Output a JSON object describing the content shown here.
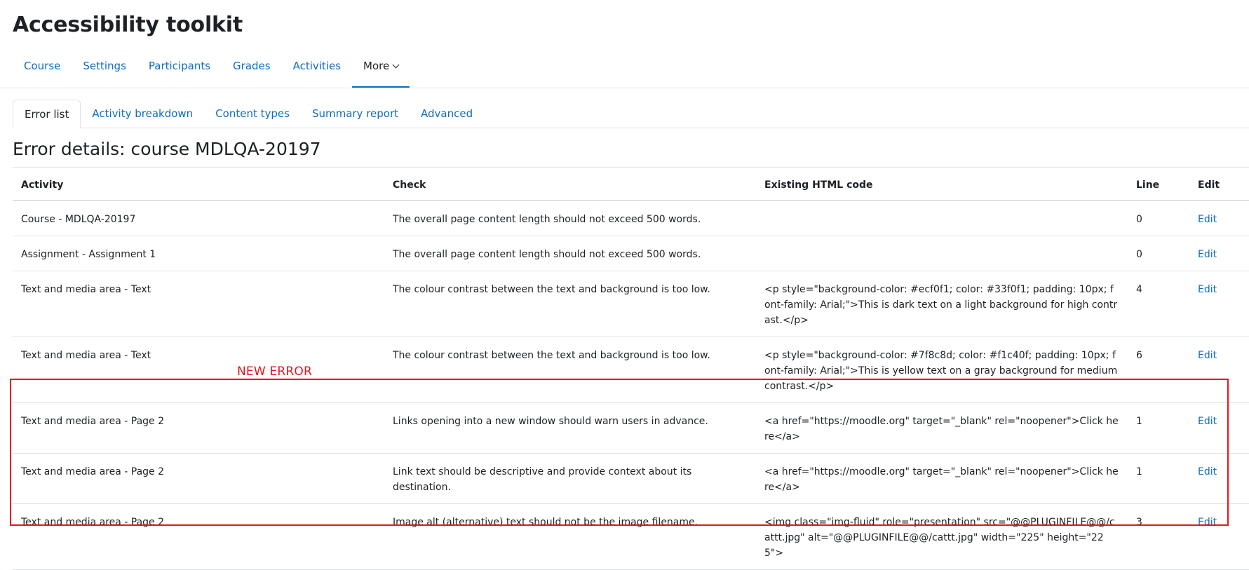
{
  "page": {
    "title": "Accessibility toolkit"
  },
  "primary_nav": {
    "items": [
      {
        "label": "Course"
      },
      {
        "label": "Settings"
      },
      {
        "label": "Participants"
      },
      {
        "label": "Grades"
      },
      {
        "label": "Activities"
      },
      {
        "label": "More"
      }
    ]
  },
  "tabs": {
    "items": [
      {
        "label": "Error list",
        "active": true
      },
      {
        "label": "Activity breakdown"
      },
      {
        "label": "Content types"
      },
      {
        "label": "Summary report"
      },
      {
        "label": "Advanced"
      }
    ]
  },
  "section": {
    "title": "Error details: course MDLQA-20197"
  },
  "table": {
    "headers": {
      "activity": "Activity",
      "check": "Check",
      "code": "Existing HTML code",
      "line": "Line",
      "edit": "Edit"
    },
    "rows": [
      {
        "activity": "Course - MDLQA-20197",
        "check": "The overall page content length should not exceed 500 words.",
        "code": "",
        "line": "0",
        "edit": "Edit"
      },
      {
        "activity": "Assignment - Assignment 1",
        "check": "The overall page content length should not exceed 500 words.",
        "code": "",
        "line": "0",
        "edit": "Edit"
      },
      {
        "activity": "Text and media area - Text",
        "check": "The colour contrast between the text and background is too low.",
        "code": "<p style=\"background-color: #ecf0f1; color: #33f0f1; padding: 10px; font-family: Arial;\">This is dark text on a light background for high contrast.</p>",
        "line": "4",
        "edit": "Edit"
      },
      {
        "activity": "Text and media area - Text",
        "check": "The colour contrast between the text and background is too low.",
        "code": "<p style=\"background-color: #7f8c8d; color: #f1c40f; padding: 10px; font-family: Arial;\">This is yellow text on a gray background for medium contrast.</p>",
        "line": "6",
        "edit": "Edit"
      },
      {
        "activity": "Text and media area - Page 2",
        "check": "Links opening into a new window should warn users in advance.",
        "code": "<a href=\"https://moodle.org\" target=\"_blank\" rel=\"noopener\">Click here</a>",
        "line": "1",
        "edit": "Edit"
      },
      {
        "activity": "Text and media area - Page 2",
        "check": "Link text should be descriptive and provide context about its destination.",
        "code": "<a href=\"https://moodle.org\" target=\"_blank\" rel=\"noopener\">Click here</a>",
        "line": "1",
        "edit": "Edit"
      },
      {
        "activity": "Text and media area - Page 2",
        "check": "Image alt (alternative) text should not be the image filename.",
        "code": "<img class=\"img-fluid\" role=\"presentation\" src=\"@@PLUGINFILE@@/cattt.jpg\" alt=\"@@PLUGINFILE@@/cattt.jpg\" width=\"225\" height=\"225\">",
        "line": "3",
        "edit": "Edit"
      }
    ]
  },
  "annotation": {
    "label": "NEW ERROR",
    "color": "#e6161c"
  },
  "colors": {
    "link": "#0f6cbf",
    "text": "#1d2125",
    "border": "#dee2e6"
  }
}
